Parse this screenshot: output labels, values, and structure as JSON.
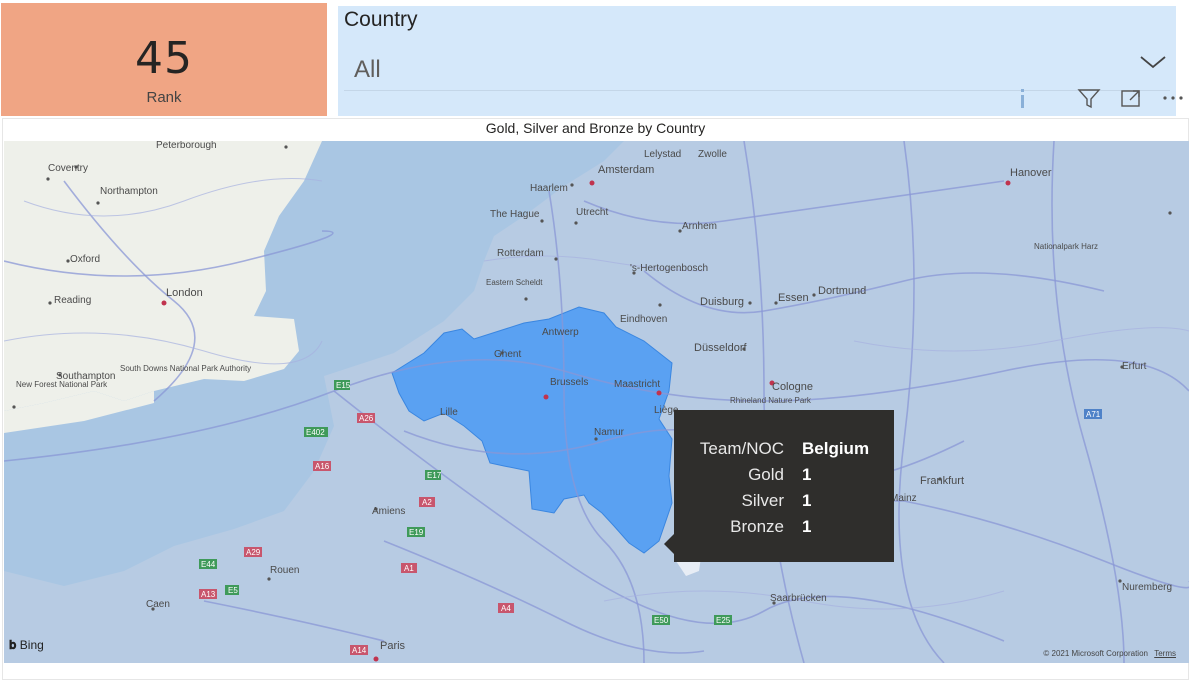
{
  "kpi": {
    "value": "45",
    "label": "Rank"
  },
  "slicer": {
    "title": "Country",
    "selected": "All"
  },
  "visual_header": {
    "icons": [
      "info-icon",
      "filter-icon",
      "focus-mode-icon",
      "more-options-icon"
    ]
  },
  "map": {
    "title": "Gold, Silver and Bronze by Country",
    "highlight_color": "#4a9af5",
    "places": [
      {
        "name": "Peterborough"
      },
      {
        "name": "Coventry"
      },
      {
        "name": "Northampton"
      },
      {
        "name": "Oxford"
      },
      {
        "name": "Reading"
      },
      {
        "name": "London"
      },
      {
        "name": "New Forest National Park"
      },
      {
        "name": "Southampton"
      },
      {
        "name": "South Downs National Park Authority"
      },
      {
        "name": "Amiens"
      },
      {
        "name": "Rouen"
      },
      {
        "name": "Caen"
      },
      {
        "name": "Paris"
      },
      {
        "name": "Lelystad"
      },
      {
        "name": "Zwolle"
      },
      {
        "name": "Amsterdam"
      },
      {
        "name": "Haarlem"
      },
      {
        "name": "The Hague"
      },
      {
        "name": "Utrecht"
      },
      {
        "name": "Arnhem"
      },
      {
        "name": "Rotterdam"
      },
      {
        "name": "'s-Hertogenbosch"
      },
      {
        "name": "Eastern Scheldt"
      },
      {
        "name": "Antwerp"
      },
      {
        "name": "Eindhoven"
      },
      {
        "name": "Ghent"
      },
      {
        "name": "Brussels"
      },
      {
        "name": "Maastricht"
      },
      {
        "name": "Lille"
      },
      {
        "name": "Namur"
      },
      {
        "name": "Liège"
      },
      {
        "name": "Duisburg"
      },
      {
        "name": "Essen"
      },
      {
        "name": "Dortmund"
      },
      {
        "name": "Düsseldorf"
      },
      {
        "name": "Cologne"
      },
      {
        "name": "Rhineland Nature Park"
      },
      {
        "name": "Hanover"
      },
      {
        "name": "Nationalpark Harz"
      },
      {
        "name": "Erfurt"
      },
      {
        "name": "Frankfurt"
      },
      {
        "name": "Mainz"
      },
      {
        "name": "Saarbrücken"
      },
      {
        "name": "Nuremberg"
      }
    ],
    "roads": [
      "E15",
      "A26",
      "E402",
      "A16",
      "E17",
      "A2",
      "E19",
      "A29",
      "E44",
      "A13",
      "E5",
      "A1",
      "A4",
      "E50",
      "E25",
      "A14",
      "A71"
    ],
    "bing_label": "Bing",
    "copyright": "© 2021 Microsoft Corporation",
    "terms": "Terms"
  },
  "tooltip": {
    "rows": [
      {
        "key": "Team/NOC",
        "value": "Belgium"
      },
      {
        "key": "Gold",
        "value": "1"
      },
      {
        "key": "Silver",
        "value": "1"
      },
      {
        "key": "Bronze",
        "value": "1"
      }
    ]
  }
}
